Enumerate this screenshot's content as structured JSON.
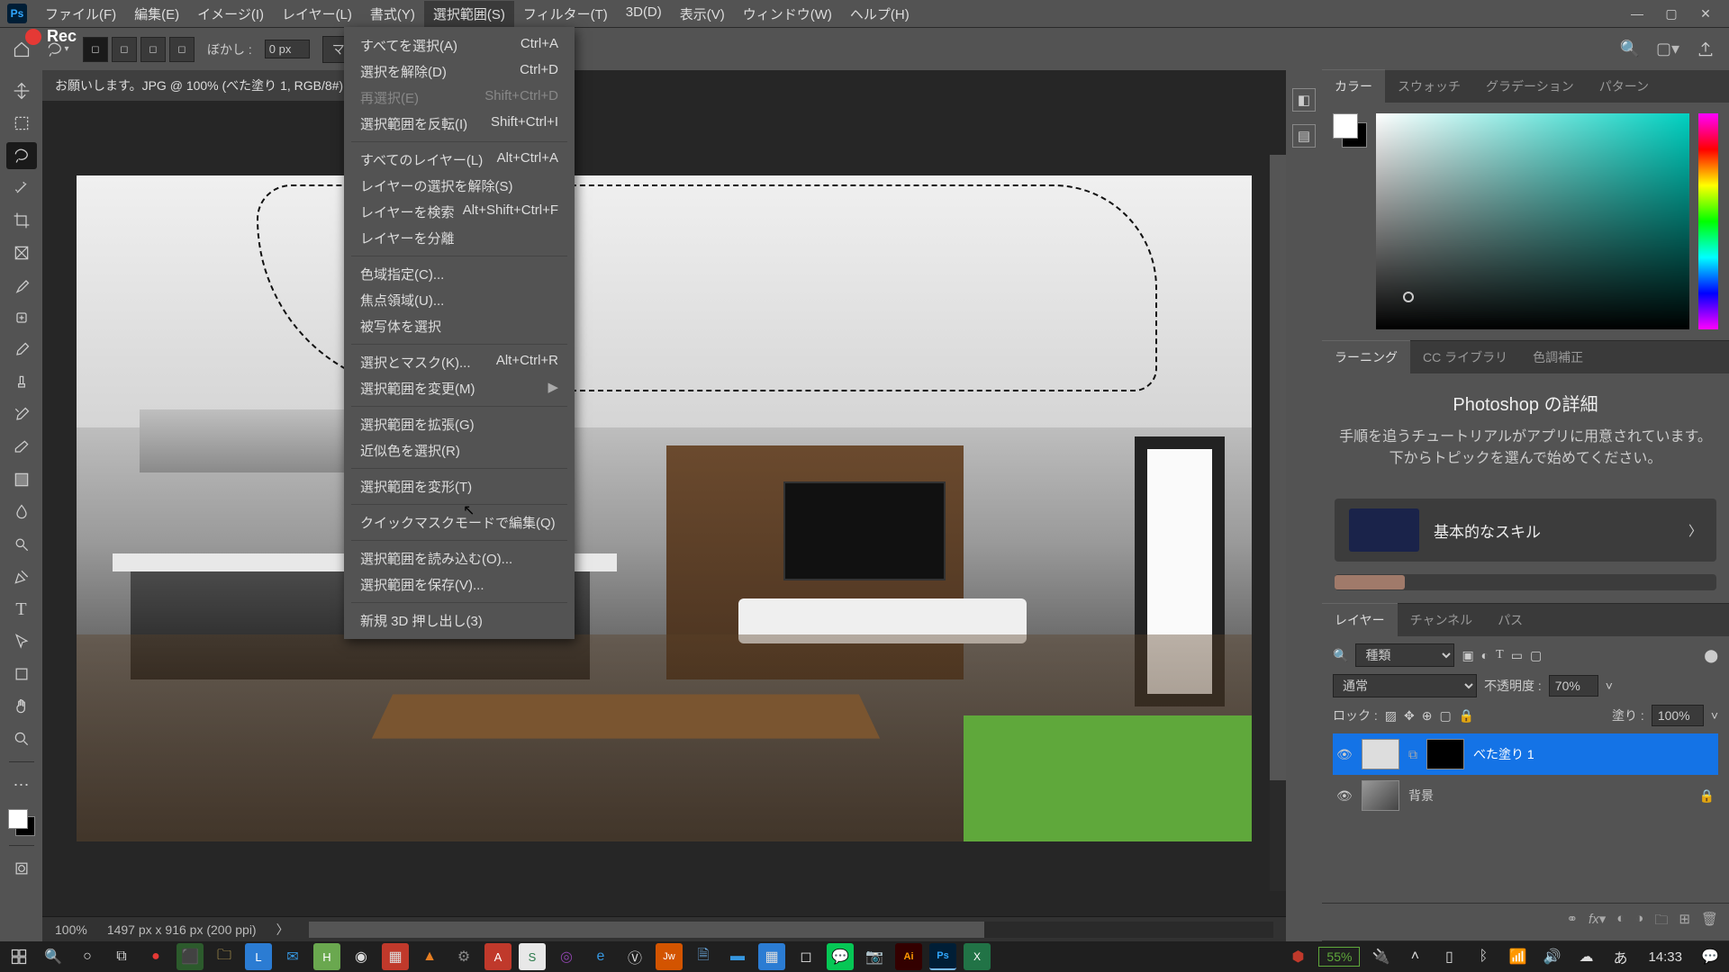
{
  "menubar": {
    "items": [
      "ファイル(F)",
      "編集(E)",
      "イメージ(I)",
      "レイヤー(L)",
      "書式(Y)",
      "選択範囲(S)",
      "フィルター(T)",
      "3D(D)",
      "表示(V)",
      "ウィンドウ(W)",
      "ヘルプ(H)"
    ],
    "active_index": 5
  },
  "rec": {
    "label": "Rec"
  },
  "optionsbar": {
    "feather_label": "ぼかし :",
    "feather_value": "0 px",
    "mask_label": "マスク..."
  },
  "doc_tab": "お願いします。JPG @ 100% (べた塗り 1, RGB/8#) *",
  "status": {
    "zoom": "100%",
    "dims": "1497 px x 916 px (200 ppi)"
  },
  "right": {
    "color_tabs": [
      "カラー",
      "スウォッチ",
      "グラデーション",
      "パターン"
    ],
    "learn_tabs": [
      "ラーニング",
      "CC ライブラリ",
      "色調補正"
    ],
    "learn_title": "Photoshop の詳細",
    "learn_desc": "手順を追うチュートリアルがアプリに用意されています。下からトピックを選んで始めてください。",
    "learn_card": "基本的なスキル",
    "layer_tabs": [
      "レイヤー",
      "チャンネル",
      "パス"
    ],
    "layer_kind_ph": "種類",
    "blend": "通常",
    "opacity_label": "不透明度 :",
    "opacity": "70%",
    "lock_label": "ロック :",
    "fill_label": "塗り :",
    "fill": "100%",
    "layers": [
      {
        "name": "べた塗り 1",
        "selected": true,
        "mask": true
      },
      {
        "name": "背景",
        "selected": false,
        "locked": true
      }
    ]
  },
  "dropdown": [
    {
      "l": "すべてを選択(A)",
      "s": "Ctrl+A"
    },
    {
      "l": "選択を解除(D)",
      "s": "Ctrl+D"
    },
    {
      "l": "再選択(E)",
      "s": "Shift+Ctrl+D",
      "dis": true
    },
    {
      "l": "選択範囲を反転(I)",
      "s": "Shift+Ctrl+I"
    },
    {
      "sep": true
    },
    {
      "l": "すべてのレイヤー(L)",
      "s": "Alt+Ctrl+A"
    },
    {
      "l": "レイヤーの選択を解除(S)"
    },
    {
      "l": "レイヤーを検索",
      "s": "Alt+Shift+Ctrl+F"
    },
    {
      "l": "レイヤーを分離"
    },
    {
      "sep": true
    },
    {
      "l": "色域指定(C)..."
    },
    {
      "l": "焦点領域(U)..."
    },
    {
      "l": "被写体を選択"
    },
    {
      "sep": true
    },
    {
      "l": "選択とマスク(K)...",
      "s": "Alt+Ctrl+R"
    },
    {
      "l": "選択範囲を変更(M)",
      "sub": true
    },
    {
      "sep": true
    },
    {
      "l": "選択範囲を拡張(G)"
    },
    {
      "l": "近似色を選択(R)"
    },
    {
      "sep": true
    },
    {
      "l": "選択範囲を変形(T)"
    },
    {
      "sep": true
    },
    {
      "l": "クイックマスクモードで編集(Q)"
    },
    {
      "sep": true
    },
    {
      "l": "選択範囲を読み込む(O)..."
    },
    {
      "l": "選択範囲を保存(V)..."
    },
    {
      "sep": true
    },
    {
      "l": "新規 3D 押し出し(3)"
    }
  ],
  "taskbar": {
    "battery": "55%",
    "ime_lang": "あ",
    "time": "14:33"
  }
}
